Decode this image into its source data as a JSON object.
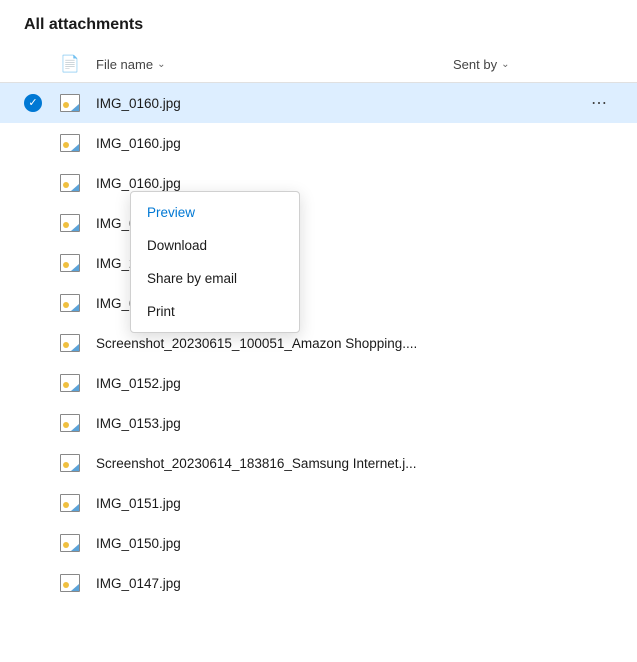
{
  "page": {
    "title": "All attachments"
  },
  "header": {
    "file_name_label": "File name",
    "sent_by_label": "Sent by"
  },
  "context_menu": {
    "items": [
      {
        "id": "preview",
        "label": "Preview",
        "active": true
      },
      {
        "id": "download",
        "label": "Download",
        "active": false
      },
      {
        "id": "share",
        "label": "Share by email",
        "active": false
      },
      {
        "id": "print",
        "label": "Print",
        "active": false
      }
    ]
  },
  "files": [
    {
      "id": 1,
      "name": "IMG_0160.jpg",
      "selected": true,
      "show_menu": true
    },
    {
      "id": 2,
      "name": "IMG_0160.jpg",
      "selected": false,
      "show_menu": false
    },
    {
      "id": 3,
      "name": "IMG_0160.jpg",
      "selected": false,
      "show_menu": false
    },
    {
      "id": 4,
      "name": "IMG_0160.jpg",
      "selected": false,
      "show_menu": false
    },
    {
      "id": 5,
      "name": "IMG_20230622_121815_475.jpg",
      "selected": false,
      "show_menu": false
    },
    {
      "id": 6,
      "name": "IMG_0157.jpg",
      "selected": false,
      "show_menu": false
    },
    {
      "id": 7,
      "name": "Screenshot_20230615_100051_Amazon Shopping....",
      "selected": false,
      "show_menu": false
    },
    {
      "id": 8,
      "name": "IMG_0152.jpg",
      "selected": false,
      "show_menu": false
    },
    {
      "id": 9,
      "name": "IMG_0153.jpg",
      "selected": false,
      "show_menu": false
    },
    {
      "id": 10,
      "name": "Screenshot_20230614_183816_Samsung Internet.j...",
      "selected": false,
      "show_menu": false
    },
    {
      "id": 11,
      "name": "IMG_0151.jpg",
      "selected": false,
      "show_menu": false
    },
    {
      "id": 12,
      "name": "IMG_0150.jpg",
      "selected": false,
      "show_menu": false
    },
    {
      "id": 13,
      "name": "IMG_0147.jpg",
      "selected": false,
      "show_menu": false
    }
  ]
}
